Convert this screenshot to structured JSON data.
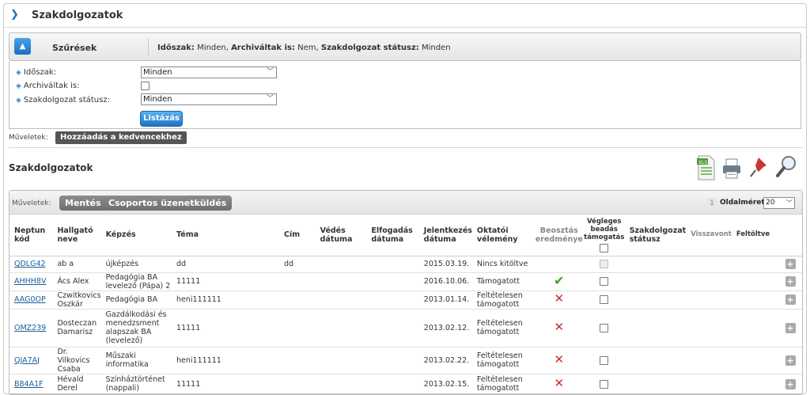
{
  "page": {
    "title": "Szakdolgozatok"
  },
  "filter": {
    "header_label": "Szűrések",
    "summary": {
      "period_key": "Időszak:",
      "period_val": "Minden",
      "archived_key": "Archiváltak is:",
      "archived_val": "Nem",
      "status_key": "Szakdolgozat státusz:",
      "status_val": "Minden"
    },
    "fields": {
      "period_label": "Időszak:",
      "period_value": "Minden",
      "archived_label": "Archiváltak is:",
      "status_label": "Szakdolgozat státusz:",
      "status_value": "Minden"
    },
    "list_button": "Listázás"
  },
  "ops_top": {
    "label": "Műveletek:",
    "button": "Hozzáadás a kedvencekhez"
  },
  "list": {
    "title": "Szakdolgozatok",
    "ops_label": "Műveletek:",
    "save_button": "Mentés",
    "group_msg_button": "Csoportos üzenetküldés",
    "page_number": "1",
    "page_size_label": "Oldalméret",
    "page_size_value": "20"
  },
  "table": {
    "headers": {
      "neptun": "Neptun kód",
      "student": "Hallgató neve",
      "program": "Képzés",
      "topic": "Téma",
      "title": "Cím",
      "defense": "Védés dátuma",
      "acceptance": "Elfogadás dátuma",
      "report": "Jelentkezés dátuma",
      "opinion": "Oktatói vélemény",
      "assignment": "Beosztás eredménye",
      "final": "Végleges beadás támogatás",
      "status": "Szakdolgozat státusz",
      "withdrawn": "Visszavont",
      "uploaded": "Feltöltve"
    },
    "rows": [
      {
        "neptun": "QDLG42",
        "student": "ab a",
        "program": "újképzés",
        "topic": "dd",
        "title": "dd",
        "report": "2015.03.19.",
        "opinion": "Nincs kitöltve",
        "assignment": ""
      },
      {
        "neptun": "AHHH8V",
        "student": "Ács Alex",
        "program": "Pedagógia BA levelező (Pápa) 2",
        "topic": "11111",
        "title": "",
        "report": "2016.10.06.",
        "opinion": "Támogatott",
        "assignment": "check"
      },
      {
        "neptun": "AAG0OP",
        "student": "Czwitkovics Oszkár",
        "program": "Pedagógia BA",
        "topic": "heni111111",
        "title": "",
        "report": "2013.01.14.",
        "opinion": "Feltételesen támogatott",
        "assignment": "cross"
      },
      {
        "neptun": "OMZ239",
        "student": "Dosteczan Damarisz",
        "program": "Gazdálkodási és menedzsment alapszak BA (levelező)",
        "topic": "11111",
        "title": "",
        "report": "2013.02.12.",
        "opinion": "Feltételesen támogatott",
        "assignment": "cross"
      },
      {
        "neptun": "QJA7AJ",
        "student": "Dr. Vilkovics Csaba",
        "program": "Műszaki informatika",
        "topic": "heni111111",
        "title": "",
        "report": "2013.02.22.",
        "opinion": "Feltételesen támogatott",
        "assignment": "cross"
      },
      {
        "neptun": "B84A1F",
        "student": "Hévald Derel",
        "program": "Színháztörténet (nappali)",
        "topic": "11111",
        "title": "",
        "report": "2013.02.15.",
        "opinion": "Feltételesen támogatott",
        "assignment": "cross"
      }
    ]
  },
  "icons": {
    "collapse": "chevron-up-icon",
    "header": "chevron-right-icon",
    "check": "check-icon",
    "cross": "cross-icon",
    "plus": "plus-icon"
  },
  "colors": {
    "accent": "#1a6fc2",
    "link": "#1a5f9e",
    "check": "#3aa91d",
    "cross": "#d32a2a"
  }
}
